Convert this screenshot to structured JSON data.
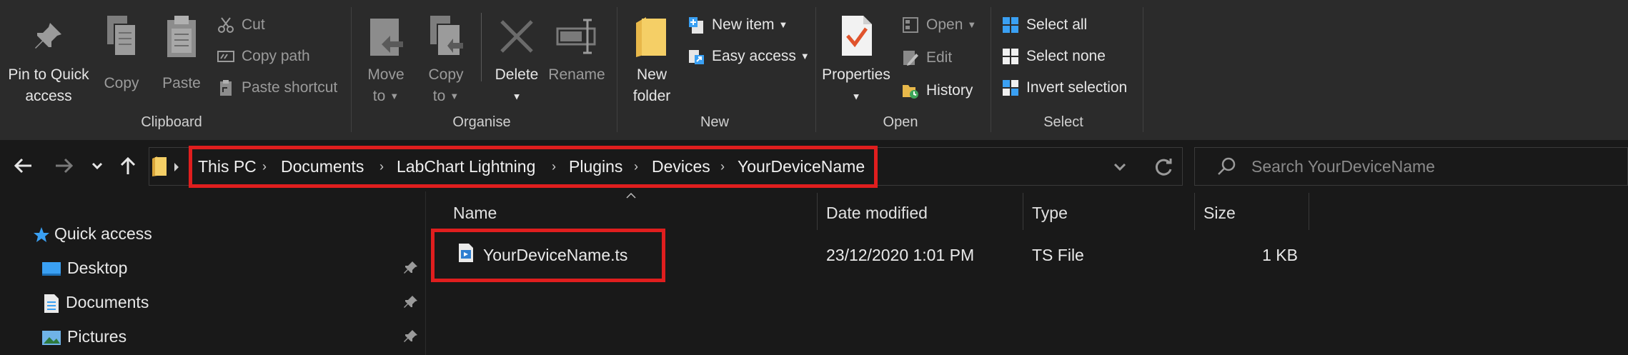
{
  "ribbon": {
    "clipboard": {
      "label": "Clipboard",
      "pin_label_line1": "Pin to Quick",
      "pin_label_line2": "access",
      "copy_label": "Copy",
      "paste_label": "Paste",
      "cut_label": "Cut",
      "copy_path_label": "Copy path",
      "paste_shortcut_label": "Paste shortcut"
    },
    "organise": {
      "label": "Organise",
      "move_label_line1": "Move",
      "move_label_line2": "to",
      "copy_label_line1": "Copy",
      "copy_label_line2": "to",
      "delete_label": "Delete",
      "rename_label": "Rename"
    },
    "new": {
      "label": "New",
      "new_folder_line1": "New",
      "new_folder_line2": "folder",
      "new_item_label": "New item",
      "easy_access_label": "Easy access"
    },
    "open": {
      "label": "Open",
      "properties_label": "Properties",
      "open_label": "Open",
      "edit_label": "Edit",
      "history_label": "History"
    },
    "select": {
      "label": "Select",
      "select_all_label": "Select all",
      "select_none_label": "Select none",
      "invert_selection_label": "Invert selection"
    }
  },
  "address": {
    "crumbs": [
      "This PC",
      "Documents",
      "LabChart Lightning",
      "Plugins",
      "Devices",
      "YourDeviceName"
    ]
  },
  "search": {
    "placeholder": "Search YourDeviceName"
  },
  "nav": {
    "quick_access": "Quick access",
    "items": [
      {
        "label": "Desktop"
      },
      {
        "label": "Documents"
      },
      {
        "label": "Pictures"
      }
    ]
  },
  "files": {
    "columns": {
      "name": "Name",
      "date_modified": "Date modified",
      "type": "Type",
      "size": "Size"
    },
    "rows": [
      {
        "name": "YourDeviceName.ts",
        "date_modified": "23/12/2020 1:01 PM",
        "type": "TS File",
        "size": "1 KB"
      }
    ]
  },
  "colors": {
    "background": "#191919",
    "ribbon": "#2b2b2b",
    "highlight": "#e01e1e",
    "accent": "#3aa0f3"
  }
}
